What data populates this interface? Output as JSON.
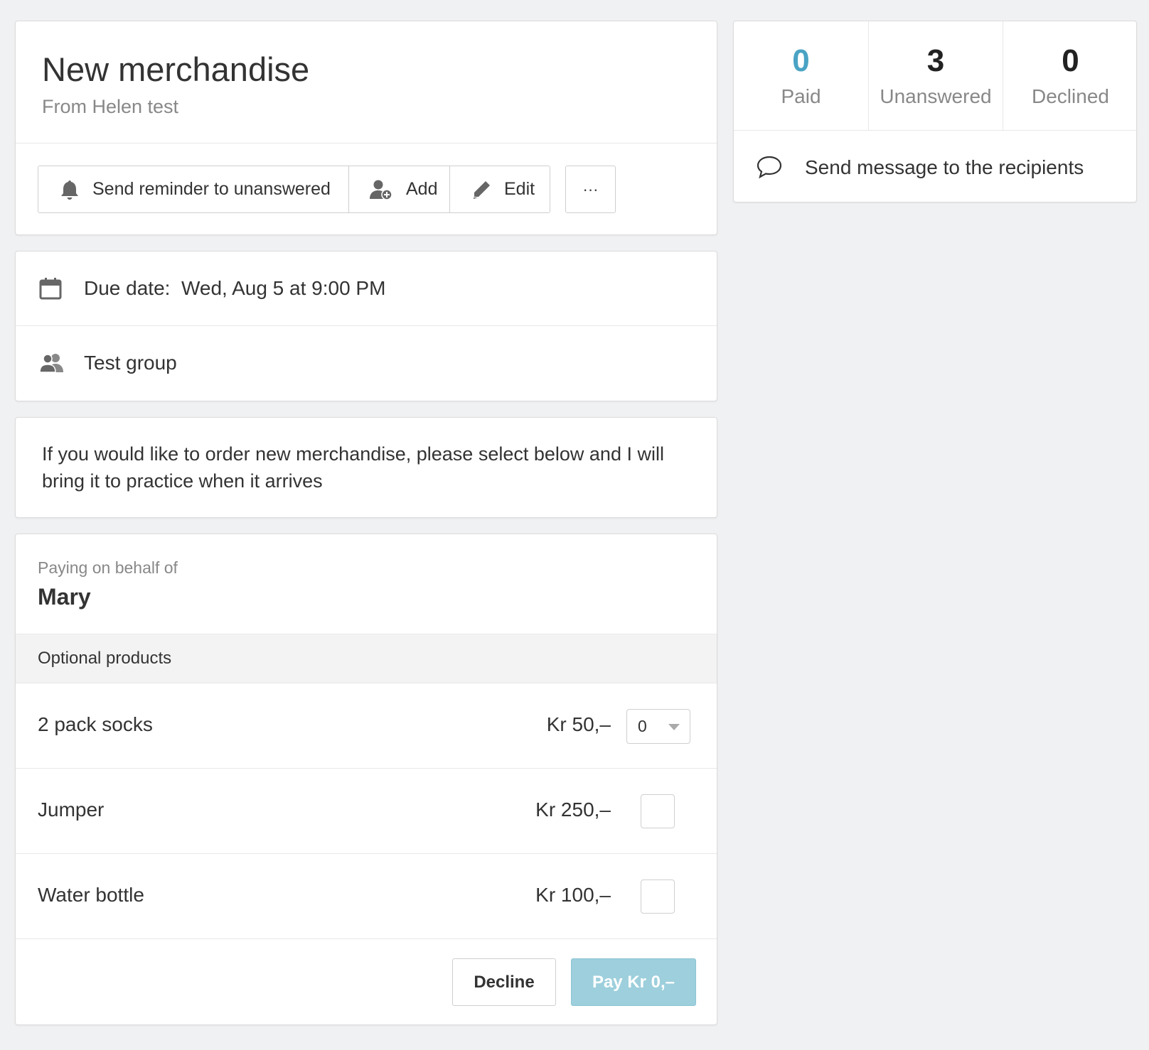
{
  "header": {
    "title": "New merchandise",
    "subtitle": "From Helen test",
    "buttons": {
      "reminder": "Send reminder to unanswered",
      "add": "Add",
      "edit": "Edit",
      "more": "···"
    }
  },
  "info": {
    "due_label": "Due date:",
    "due_value": "Wed, Aug 5 at 9:00 PM",
    "group": "Test group"
  },
  "description": "If you would like to order new merchandise, please select below and I will bring it to practice when it arrives",
  "payment": {
    "behalf_label": "Paying on behalf of",
    "behalf_name": "Mary",
    "section_label": "Optional products",
    "products": [
      {
        "name": "2 pack socks",
        "price": "Kr 50,–",
        "control": "select",
        "quantity": "0"
      },
      {
        "name": "Jumper",
        "price": "Kr 250,–",
        "control": "checkbox",
        "checked": false
      },
      {
        "name": "Water bottle",
        "price": "Kr 100,–",
        "control": "checkbox",
        "checked": false
      }
    ],
    "decline_label": "Decline",
    "pay_label": "Pay Kr 0,–"
  },
  "stats": {
    "paid": {
      "value": "0",
      "label": "Paid",
      "color": "#4aa3c4"
    },
    "unanswered": {
      "value": "3",
      "label": "Unanswered",
      "color": "#222222"
    },
    "declined": {
      "value": "0",
      "label": "Declined",
      "color": "#222222"
    },
    "message_label": "Send message to the recipients"
  },
  "icons": {
    "reminder": "bell-icon",
    "add": "add-user-icon",
    "edit": "pencil-icon",
    "due": "calendar-icon",
    "group": "group-icon",
    "message": "speech-bubble-icon",
    "select": "chevron-down-icon"
  }
}
